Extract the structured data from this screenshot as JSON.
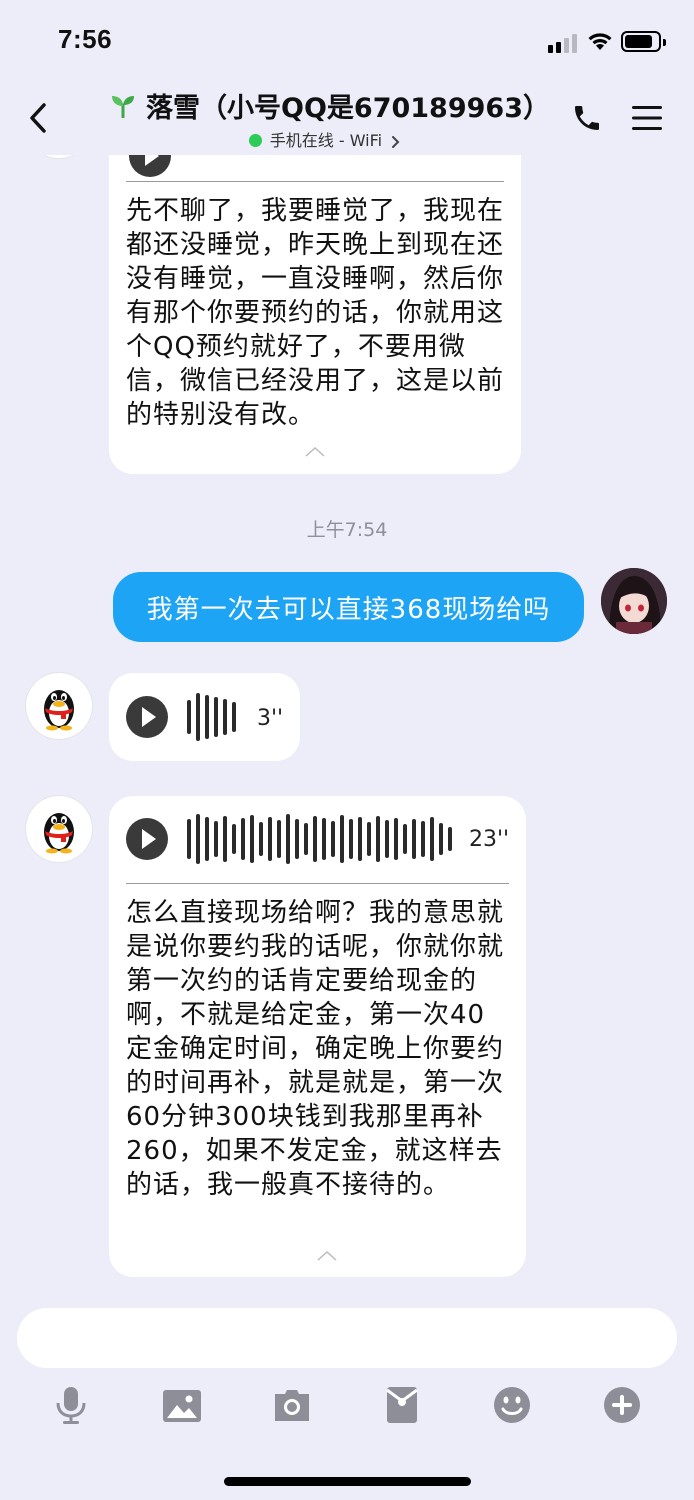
{
  "status_bar": {
    "time": "7:56"
  },
  "header": {
    "title": "落雪（小号QQ是670189963）",
    "status": "手机在线 - WiFi"
  },
  "messages": {
    "voice1_transcript": "先不聊了，我要睡觉了，我现在都还没睡觉，昨天晚上到现在还没有睡觉，一直没睡啊，然后你有那个你要预约的话，你就用这个QQ预约就好了，不要用微信，微信已经没用了，这是以前的特别没有改。",
    "timestamp": "上午7:54",
    "outgoing_text": "我第一次去可以直接368现场给吗",
    "voice2_duration": "3''",
    "voice3_duration": "23''",
    "voice3_transcript": "怎么直接现场给啊？我的意思就是说你要约我的话呢，你就你就第一次约的话肯定要给现金的啊，不就是给定金，第一次40定金确定时间，确定晚上你要约的时间再补，就是就是，第一次60分钟300块钱到我那里再补260，如果不发定金，就这样去的话，我一般真不接待的。"
  },
  "input": {
    "value": "",
    "placeholder": ""
  },
  "toolbar": {
    "icons": [
      "microphone-icon",
      "image-icon",
      "camera-icon",
      "red-packet-icon",
      "emoji-icon",
      "plus-icon"
    ]
  },
  "colors": {
    "background": "#ECEDF8",
    "outgoing_bubble": "#1EA4F4",
    "online_dot": "#2DCB58",
    "toolbar_icon": "#8E8E99"
  }
}
